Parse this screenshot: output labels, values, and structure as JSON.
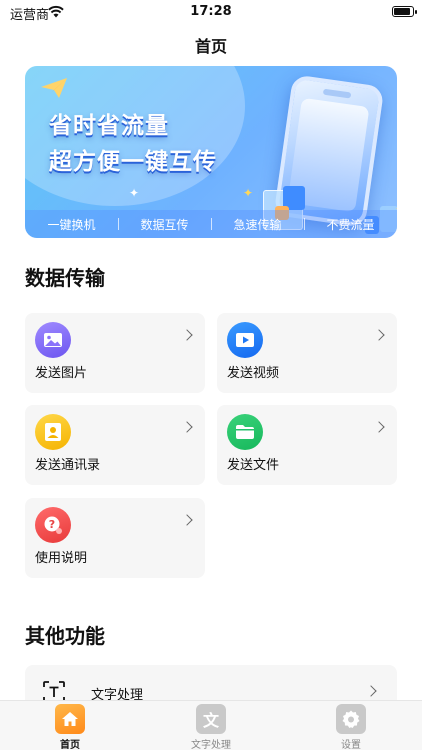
{
  "status_bar": {
    "carrier": "运营商",
    "time": "17:28"
  },
  "nav": {
    "title": "首页"
  },
  "banner": {
    "headline_line1": "省时省流量",
    "headline_line2": "超方便一键互传",
    "tabs": [
      "一键换机",
      "数据互传",
      "急速传输",
      "不费流量"
    ]
  },
  "sections": {
    "data_transfer_title": "数据传输",
    "other_functions_title": "其他功能"
  },
  "cards": [
    {
      "label": "发送图片",
      "icon": "image-icon"
    },
    {
      "label": "发送视频",
      "icon": "video-icon"
    },
    {
      "label": "发送通讯录",
      "icon": "contacts-icon"
    },
    {
      "label": "发送文件",
      "icon": "folder-icon"
    },
    {
      "label": "使用说明",
      "icon": "help-icon"
    }
  ],
  "functions": [
    {
      "label": "文字处理",
      "icon": "text-scan-icon"
    }
  ],
  "tabbar": {
    "items": [
      {
        "label": "首页",
        "icon": "home-icon"
      },
      {
        "label": "文字处理",
        "icon": "text-icon",
        "glyph": "文"
      },
      {
        "label": "设置",
        "icon": "gear-icon"
      }
    ]
  },
  "colors": {
    "accent": "#ff9d1a",
    "banner_start": "#5ec8f6",
    "banner_end": "#8fc0ff"
  }
}
